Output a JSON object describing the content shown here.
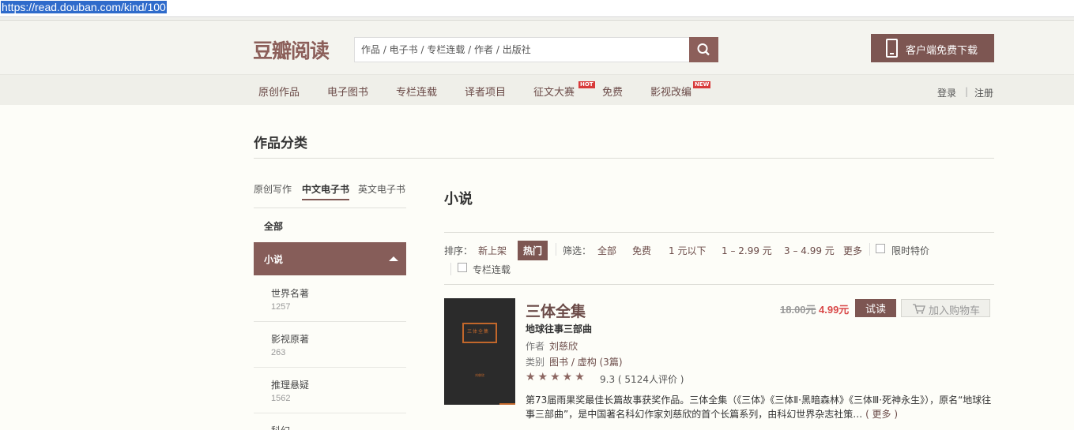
{
  "browser": {
    "url": "https://read.douban.com/kind/100"
  },
  "header": {
    "logo": "豆瓣阅读",
    "search_placeholder": "作品 / 电子书 / 专栏连载 / 作者 / 出版社",
    "app_download": "客户端免费下载"
  },
  "nav": {
    "items": [
      "原创作品",
      "电子图书",
      "专栏连载",
      "译者项目",
      "征文大赛",
      "免费",
      "影视改编"
    ],
    "badges": {
      "contest": "HOT",
      "adapt": "NEW"
    },
    "login": "登录",
    "register": "注册",
    "separator": "|"
  },
  "page": {
    "title": "作品分类"
  },
  "sidebar": {
    "tabs": [
      "原创写作",
      "中文电子书",
      "英文电子书"
    ],
    "all": "全部",
    "active": "小说",
    "subcategories": [
      {
        "name": "世界名著",
        "count": "1257"
      },
      {
        "name": "影视原著",
        "count": "263"
      },
      {
        "name": "推理悬疑",
        "count": "1562"
      },
      {
        "name": "科幻",
        "count": ""
      }
    ]
  },
  "main": {
    "category": "小说",
    "sort_label": "排序：",
    "sort_options": [
      "新上架",
      "热门"
    ],
    "filter_label": "筛选：",
    "filter_options": [
      "全部",
      "免费",
      "1 元以下",
      "1 – 2.99 元",
      "3 – 4.99 元",
      "更多"
    ],
    "checkboxes": [
      "限时特价",
      "专栏连载"
    ]
  },
  "book": {
    "title": "三体全集",
    "subtitle": "地球往事三部曲",
    "author_label": "作者",
    "author": "刘慈欣",
    "category_label": "类别",
    "category": "图书 / 虚构 (3篇)",
    "rating": "9.3",
    "reviews": "( 5124人评价 )",
    "stars": "★★★★★",
    "old_price": "18.00元",
    "price": "4.99元",
    "try_label": "试读",
    "cart_label": "加入购物车",
    "description": "第73届雨果奖最佳长篇故事获奖作品。三体全集（《三体》《三体Ⅱ·黑暗森林》《三体Ⅲ·死神永生》），原名“地球往事三部曲”，是中国著名科幻作家刘慈欣的首个长篇系列，由科幻世界杂志社策…",
    "more": "( 更多 )",
    "cover_text": "三体全集"
  }
}
